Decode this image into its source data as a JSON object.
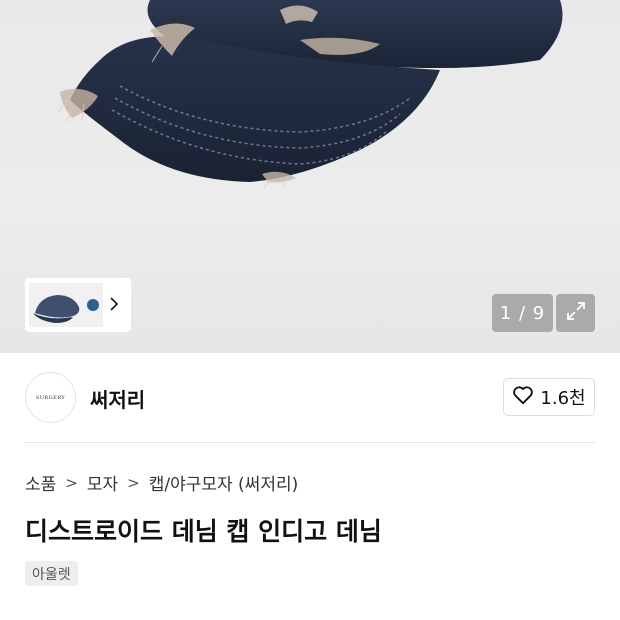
{
  "gallery": {
    "image_alt": "디스트로이드 데님 캡 인디고 데님",
    "page_counter": "1 / 9",
    "thumb_next_icon": "chevron-right-icon",
    "expand_icon": "expand-icon"
  },
  "brand": {
    "name": "써저리",
    "logo_text": "SURGERY",
    "like_icon": "heart-outline-icon",
    "like_count": "1.6천"
  },
  "breadcrumb": {
    "items": [
      "소품",
      "모자",
      "캡/야구모자 (써저리)"
    ],
    "separator": ">"
  },
  "product": {
    "title": "디스트로이드 데님 캡 인디고 데님",
    "tag": "아울렛"
  },
  "colors": {
    "denim_dark": "#1f2a3d",
    "denim_mid": "#34425a",
    "gallery_bg": "#ebebeb",
    "overlay_gray": "#969696"
  }
}
